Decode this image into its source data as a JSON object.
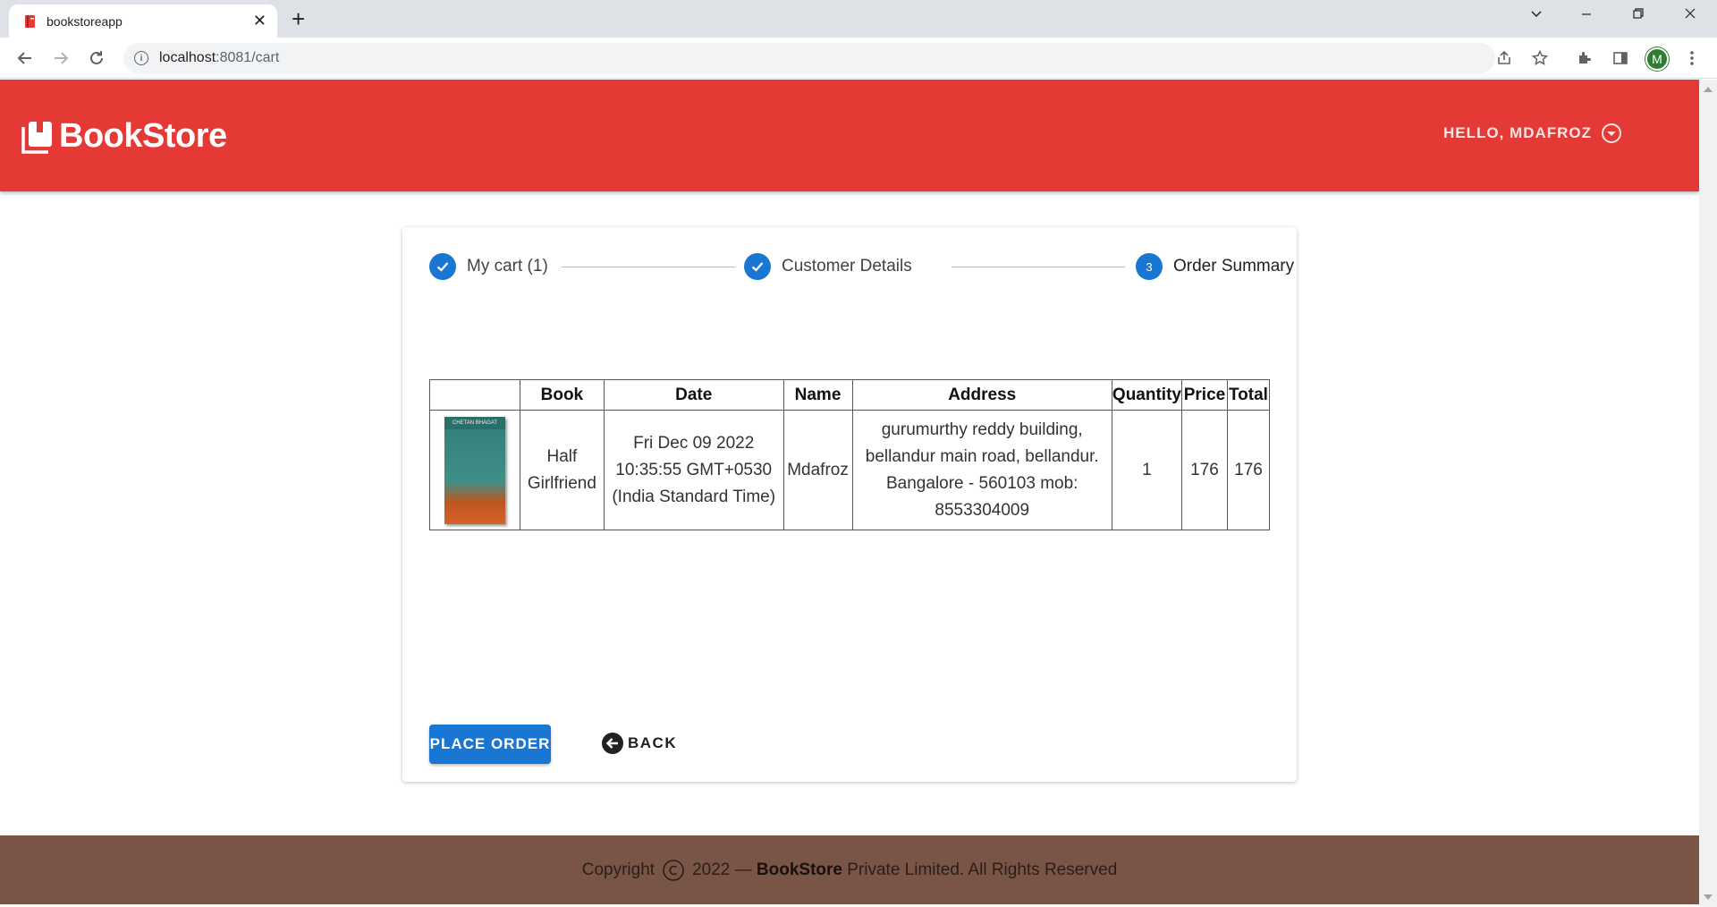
{
  "browser": {
    "tab_title": "bookstoreapp",
    "url_host": "localhost",
    "url_path": ":8081/cart",
    "profile_initial": "M"
  },
  "header": {
    "brand": "BookStore",
    "greeting": "HELLO, MDAFROZ",
    "color": "#e53935"
  },
  "stepper": {
    "steps": [
      {
        "label": "My cart (1)",
        "state": "done"
      },
      {
        "label": "Customer Details",
        "state": "done"
      },
      {
        "label": "Order Summary",
        "state": "active",
        "number": "3"
      }
    ]
  },
  "table": {
    "headers": [
      "",
      "Book",
      "Date",
      "Name",
      "Address",
      "Quantity",
      "Price",
      "Total"
    ],
    "rows": [
      {
        "cover_text": "CHETAN BHAGAT",
        "book": "Half Girlfriend",
        "date": "Fri Dec 09 2022 10:35:55 GMT+0530 (India Standard Time)",
        "name": "Mdafroz",
        "address": "gurumurthy reddy building, bellandur main road, bellandur. Bangalore - 560103 mob: 8553304009",
        "quantity": "1",
        "price": "176",
        "total": "176"
      }
    ]
  },
  "actions": {
    "place_order": "PLACE ORDER",
    "back": "BACK",
    "primary_color": "#1976d2"
  },
  "footer": {
    "copyright": "Copyright",
    "year_text": "2022 —",
    "brand": "BookStore",
    "rest": "Private Limited. All Rights Reserved",
    "color": "#795548"
  }
}
